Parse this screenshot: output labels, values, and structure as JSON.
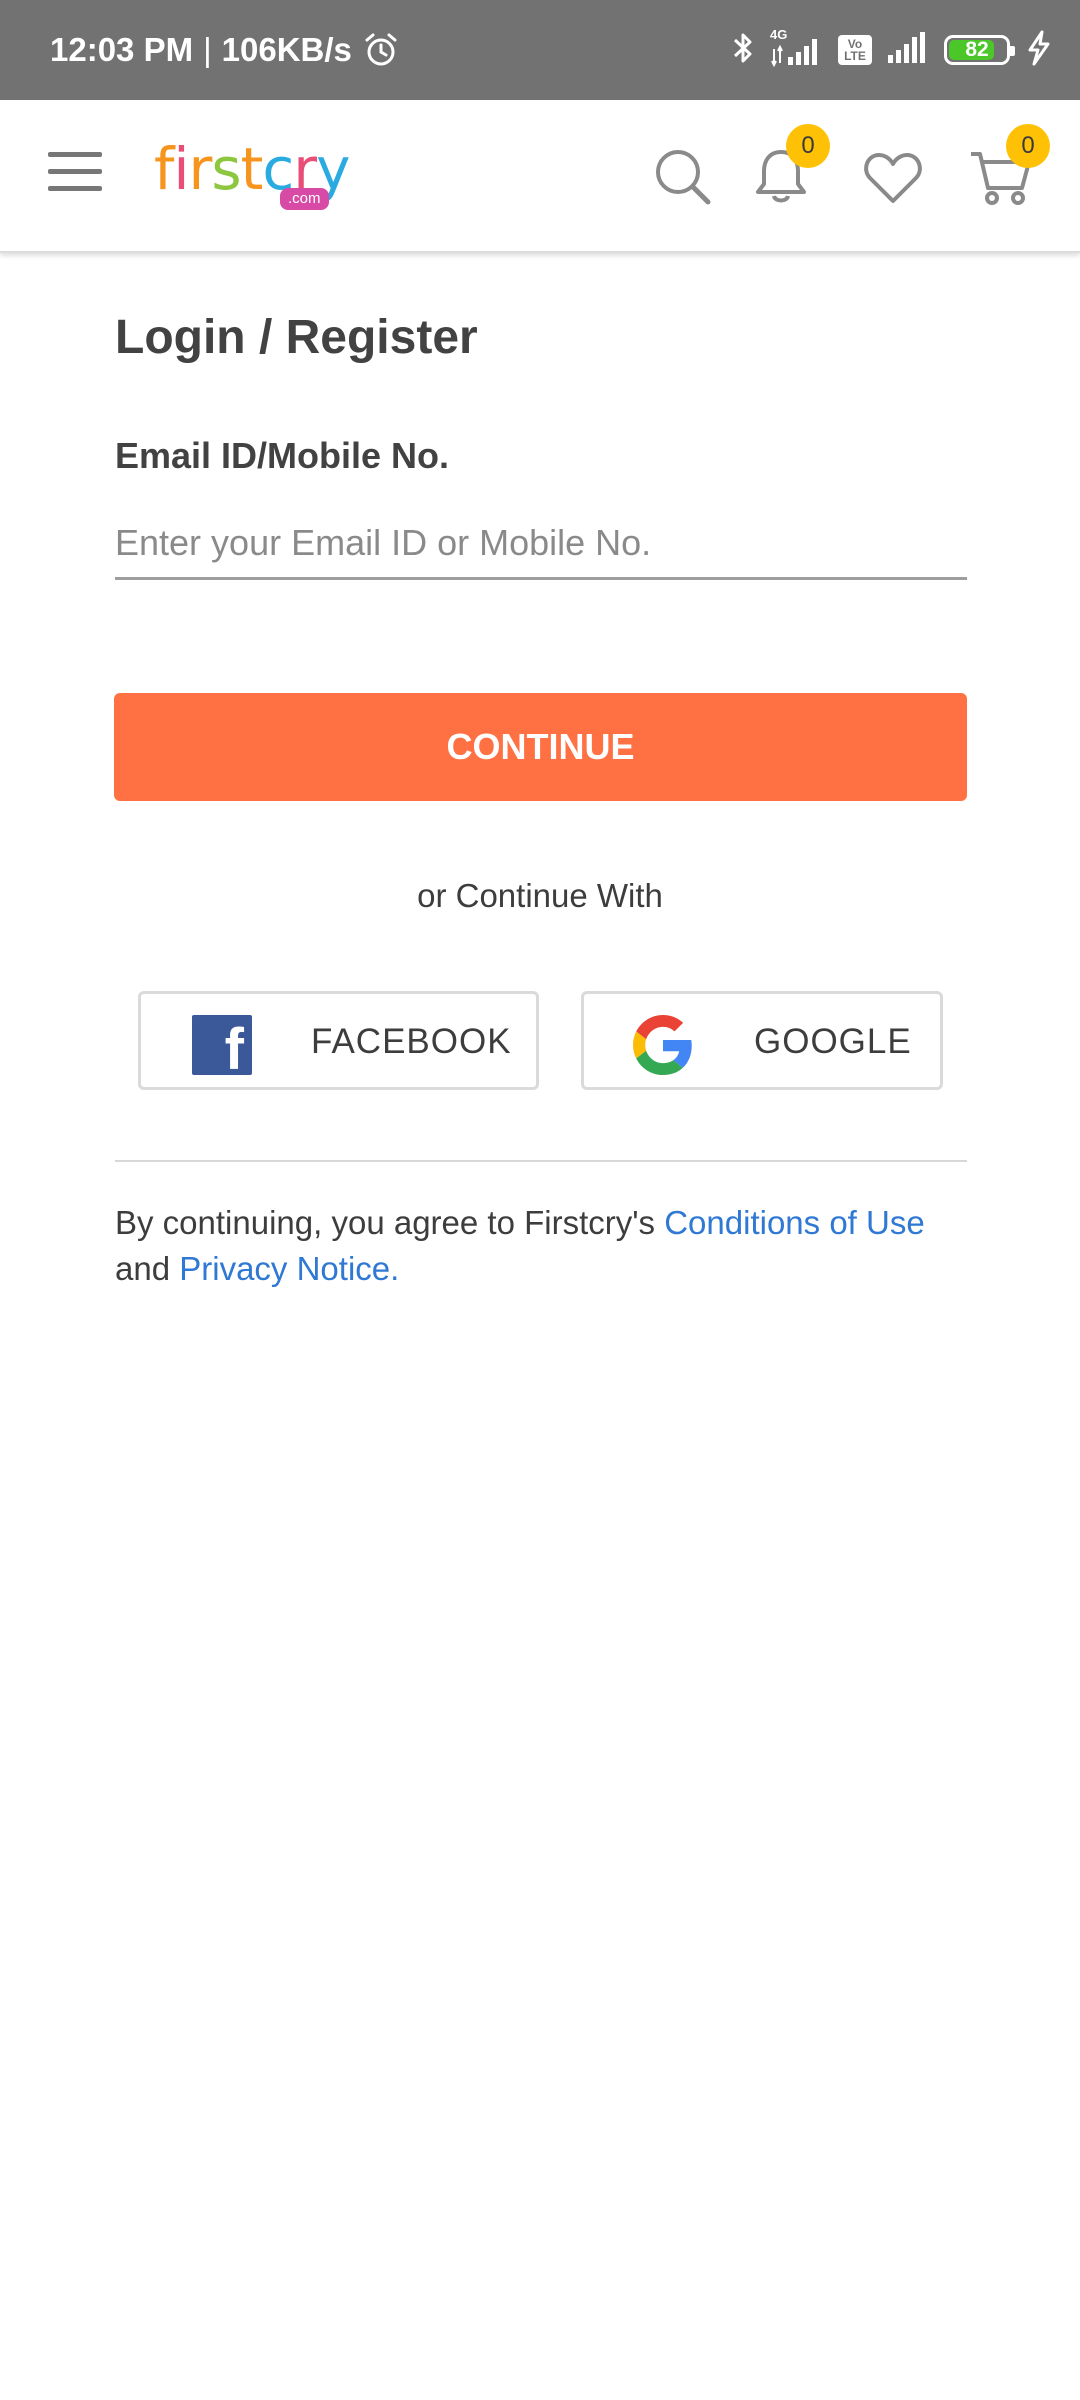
{
  "status_bar": {
    "time": "12:03 PM",
    "separator": "|",
    "network_speed": "106KB/s",
    "network_type": "4G",
    "volte_label_top": "Vo",
    "volte_label_bottom": "LTE",
    "battery_level": 82,
    "battery_text": "82",
    "battery_color": "#4cc72a",
    "icons": [
      "alarm-icon",
      "bluetooth-icon",
      "signal-icon",
      "volte-icon",
      "signal-icon",
      "battery-icon",
      "charging-icon"
    ]
  },
  "header": {
    "logo_text": "firstcry",
    "logo_suffix": ".com",
    "notifications_count": "0",
    "cart_count": "0",
    "icons": [
      "menu-icon",
      "search-icon",
      "bell-icon",
      "heart-icon",
      "cart-icon"
    ]
  },
  "login": {
    "title": "Login / Register",
    "field_label": "Email ID/Mobile No.",
    "email_value": "",
    "email_placeholder": "Enter your Email ID or Mobile No.",
    "continue_label": "CONTINUE",
    "or_text": "or Continue With",
    "facebook_label": "FACEBOOK",
    "google_label": "GOOGLE",
    "legal_prefix": "By continuing, you agree to Firstcry's",
    "conditions_link": "Conditions of Use",
    "legal_and": "and",
    "privacy_link": "Privacy Notice."
  },
  "colors": {
    "status_bar_bg": "#727272",
    "accent_button": "#ff7043",
    "link": "#2f78d3",
    "badge": "#ffc106",
    "facebook": "#3b5998"
  }
}
